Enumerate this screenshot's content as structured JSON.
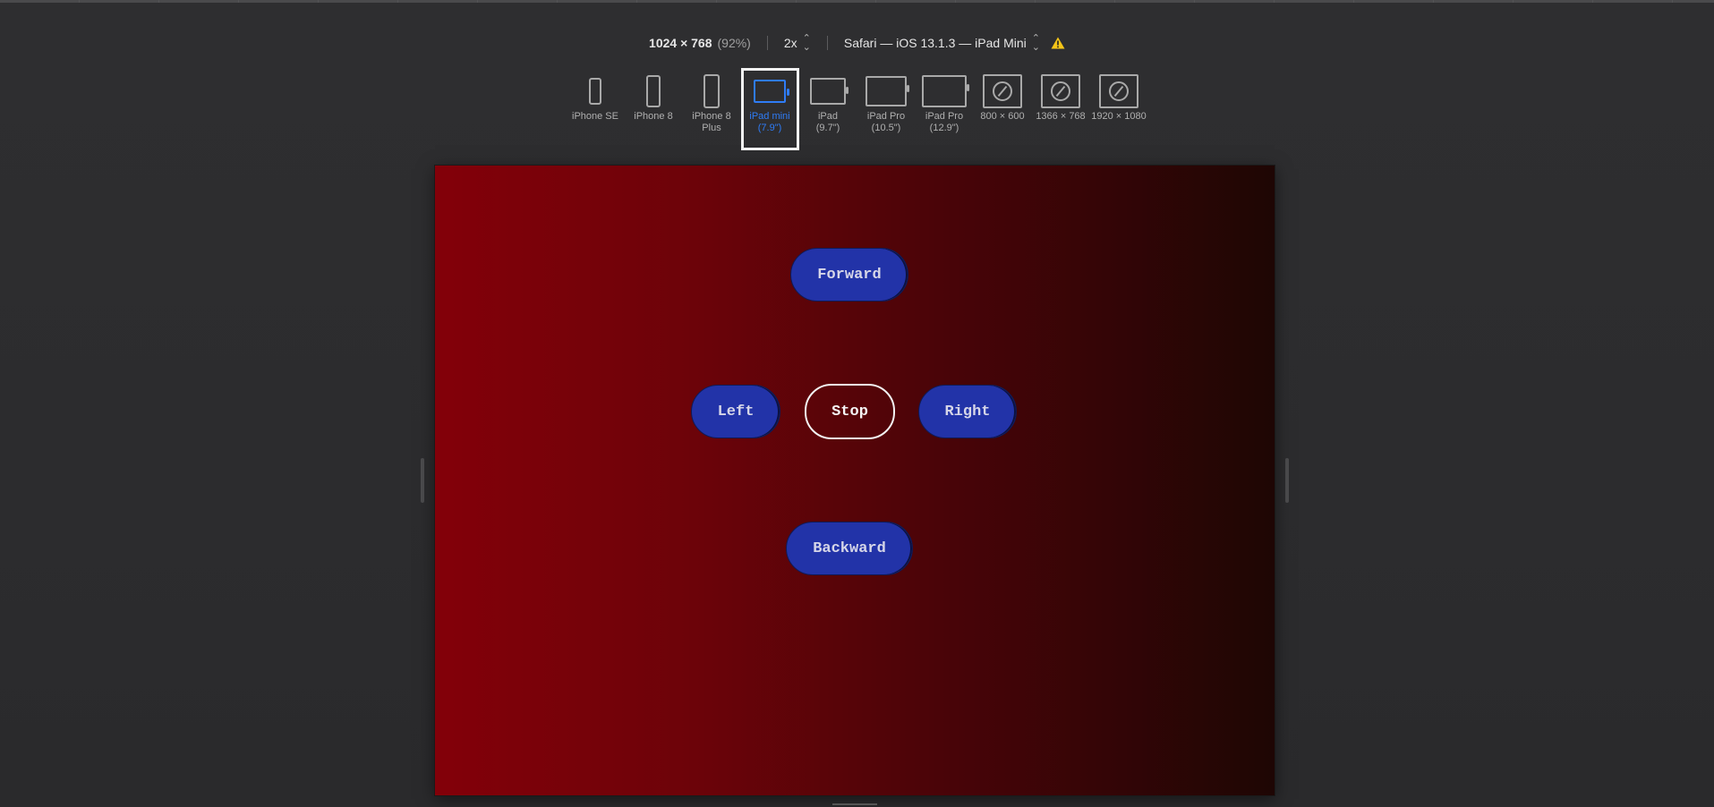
{
  "toolbar": {
    "resolution": "1024 × 768",
    "zoom": "(92%)",
    "scale": "2x",
    "browser": "Safari — iOS 13.1.3 — iPad Mini",
    "warning_icon": "warning-triangle-icon"
  },
  "devices": [
    {
      "id": "iphone-se",
      "line1": "iPhone SE",
      "line2": "",
      "icon": "phone-icon"
    },
    {
      "id": "iphone-8",
      "line1": "iPhone 8",
      "line2": "",
      "icon": "phone-icon"
    },
    {
      "id": "iphone-8-plus",
      "line1": "iPhone 8",
      "line2": "Plus",
      "icon": "phone-icon"
    },
    {
      "id": "ipad-mini",
      "line1": "iPad mini",
      "line2": "(7.9\")",
      "icon": "tablet-icon",
      "selected": true
    },
    {
      "id": "ipad",
      "line1": "iPad",
      "line2": "(9.7\")",
      "icon": "tablet-icon"
    },
    {
      "id": "ipad-pro-10",
      "line1": "iPad Pro",
      "line2": "(10.5\")",
      "icon": "tablet-icon"
    },
    {
      "id": "ipad-pro-12",
      "line1": "iPad Pro",
      "line2": "(12.9\")",
      "icon": "tablet-icon"
    },
    {
      "id": "800x600",
      "line1": "800 × 600",
      "line2": "",
      "icon": "compass-icon"
    },
    {
      "id": "1366x768",
      "line1": "1366 × 768",
      "line2": "",
      "icon": "compass-icon"
    },
    {
      "id": "1920x1080",
      "line1": "1920 × 1080",
      "line2": "",
      "icon": "compass-icon"
    }
  ],
  "controls": {
    "forward": "Forward",
    "left": "Left",
    "stop": "Stop",
    "right": "Right",
    "backward": "Backward"
  },
  "colors": {
    "selected_accent": "#2f7cf6",
    "button_fill": "#2233a8",
    "gradient_start": "#830009",
    "gradient_end": "#1e0604"
  }
}
